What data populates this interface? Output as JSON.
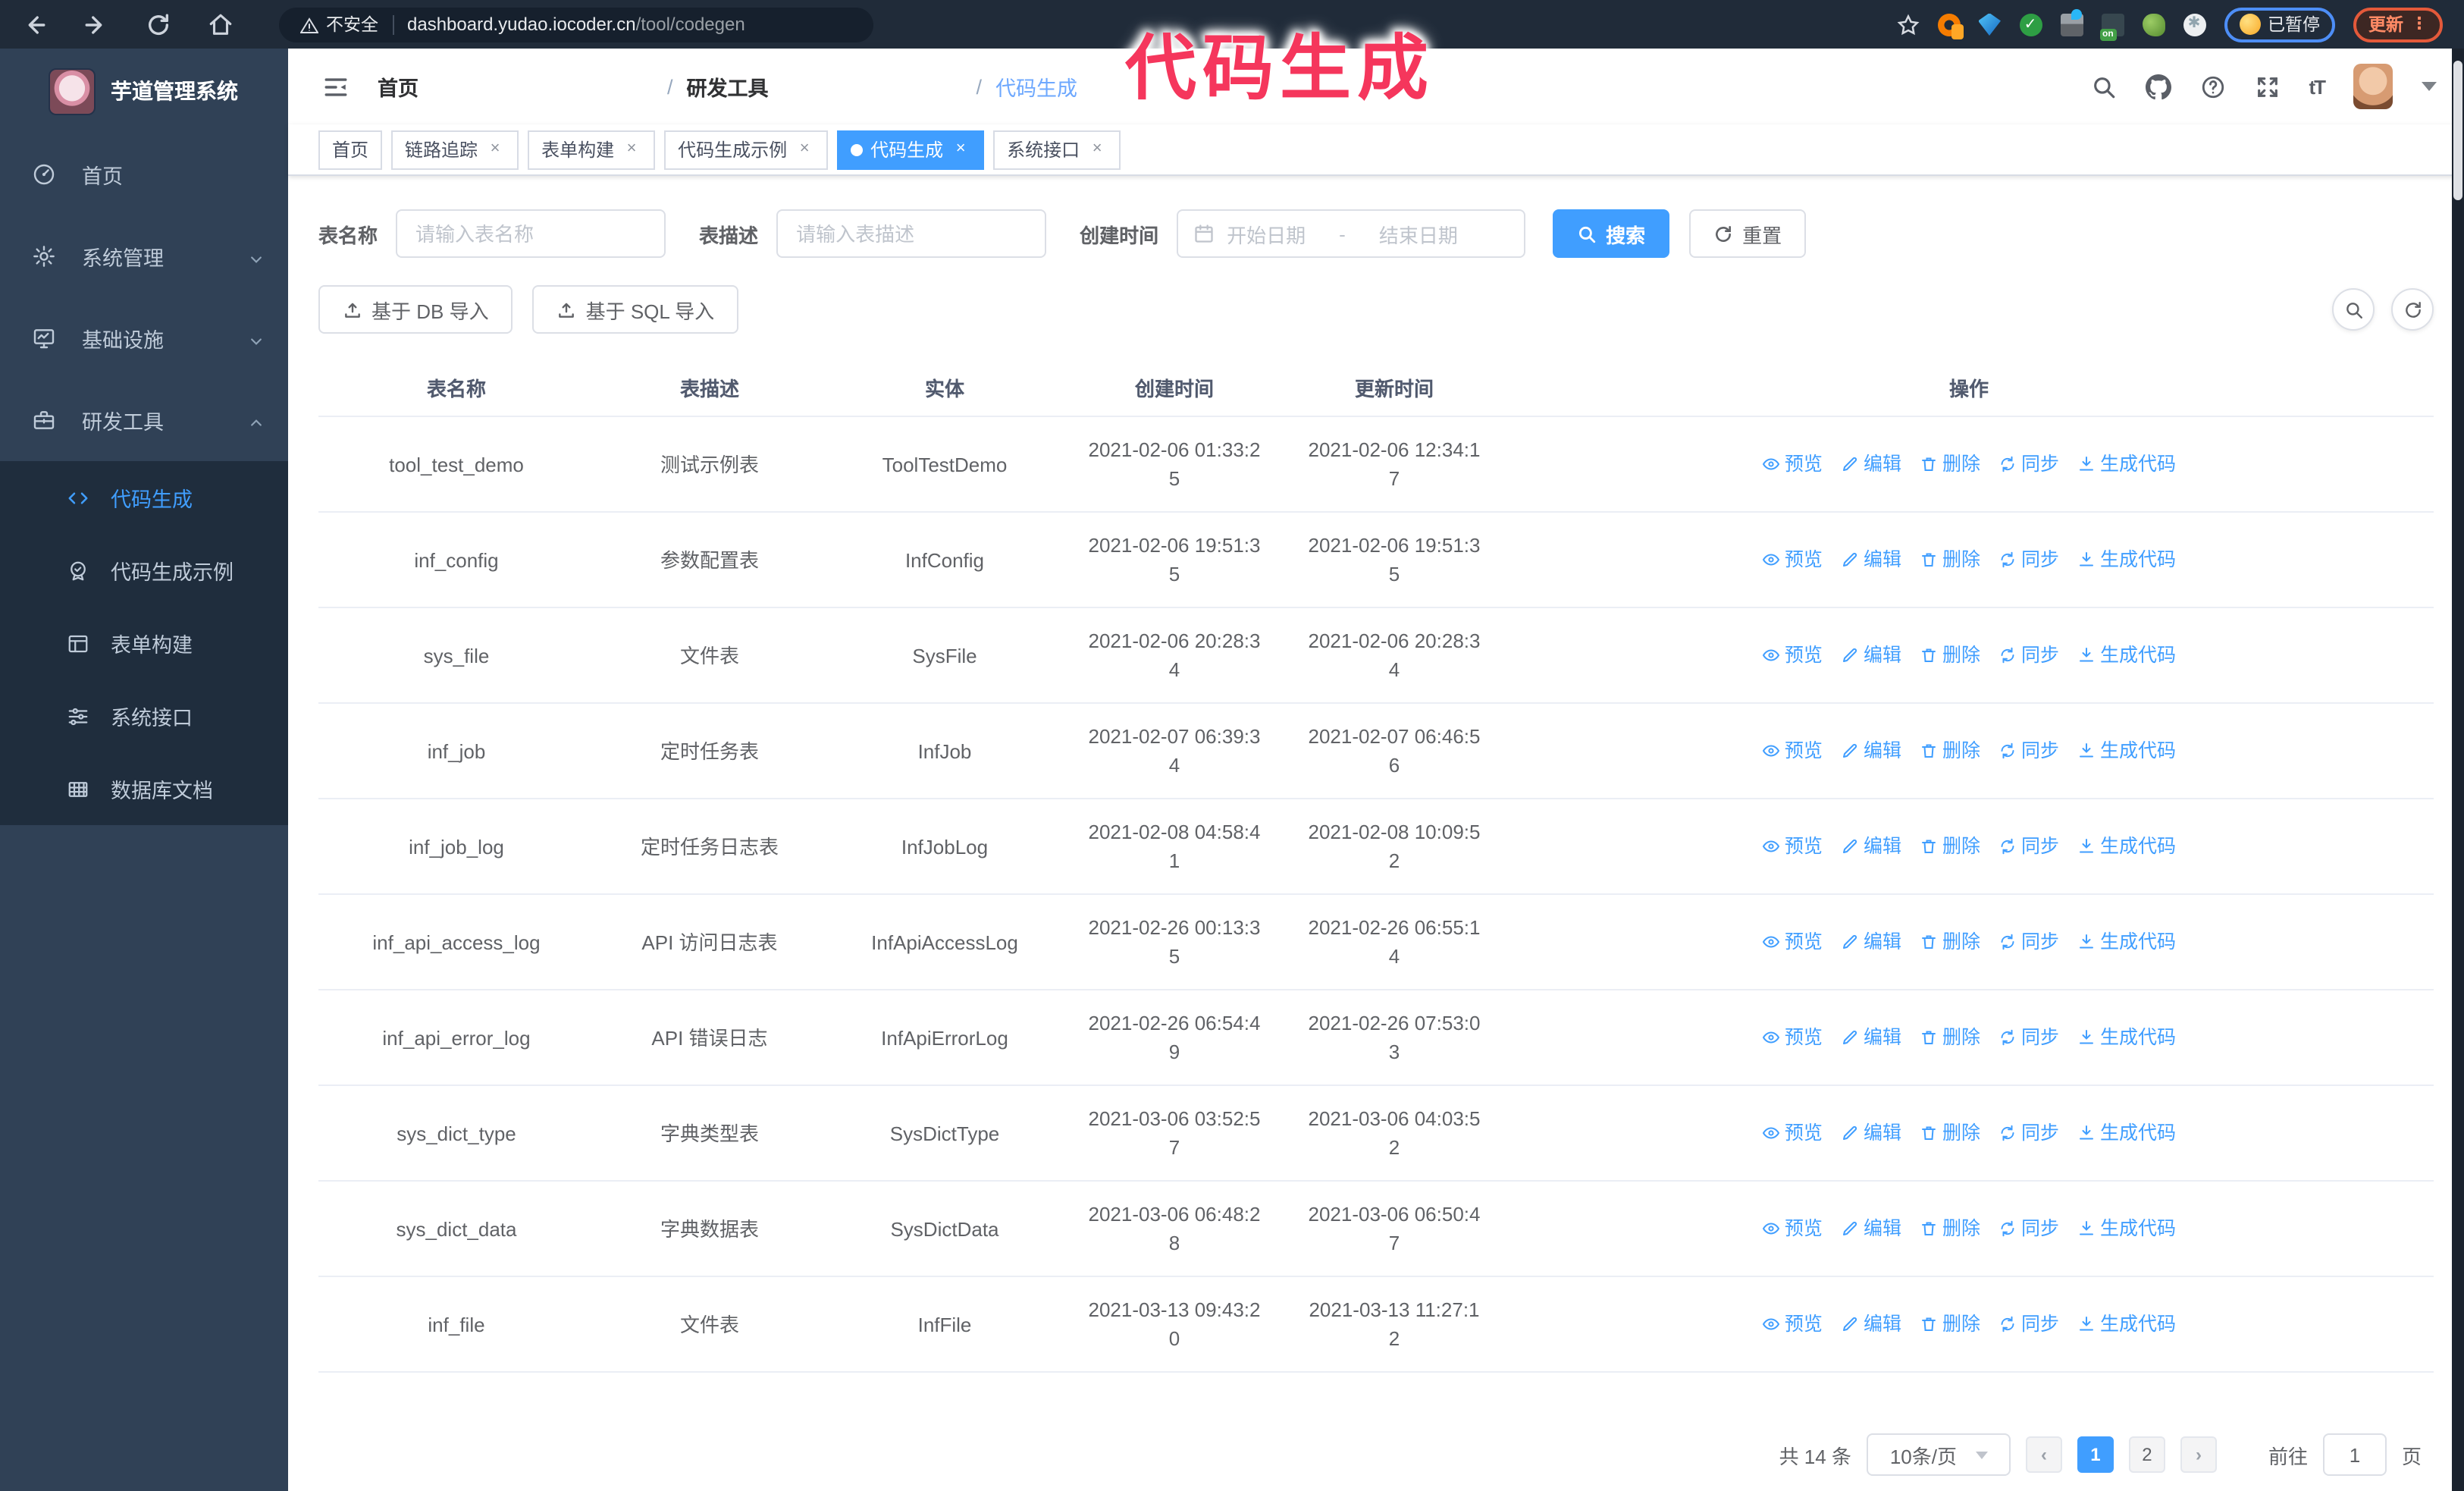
{
  "theme": {
    "accent": "#409eff",
    "sidebar": "#304156",
    "submenu": "#1f2d3d",
    "chrome": "#202b39",
    "annotation": "#f5365c"
  },
  "browser": {
    "security_label": "不安全",
    "url_host": "dashboard.yudao.iocoder.cn",
    "url_path": "/tool/codegen",
    "paused_badge": "已暂停",
    "update_button": "更新",
    "menu_dots": "⋮"
  },
  "annotation": {
    "text": "代码生成"
  },
  "sidebar": {
    "title": "芋道管理系统",
    "items": [
      {
        "label": "首页"
      },
      {
        "label": "系统管理"
      },
      {
        "label": "基础设施"
      },
      {
        "label": "研发工具"
      }
    ],
    "subitems": [
      {
        "label": "代码生成",
        "active": true
      },
      {
        "label": "代码生成示例"
      },
      {
        "label": "表单构建"
      },
      {
        "label": "系统接口"
      },
      {
        "label": "数据库文档"
      }
    ]
  },
  "breadcrumb": {
    "home": "首页",
    "section": "研发工具",
    "current": "代码生成",
    "separator": "/"
  },
  "tabs": [
    {
      "label": "首页"
    },
    {
      "label": "链路追踪"
    },
    {
      "label": "表单构建"
    },
    {
      "label": "代码生成示例"
    },
    {
      "label": "代码生成",
      "active": true
    },
    {
      "label": "系统接口"
    }
  ],
  "filters": {
    "name_label": "表名称",
    "name_placeholder": "请输入表名称",
    "desc_label": "表描述",
    "desc_placeholder": "请输入表描述",
    "time_label": "创建时间",
    "range_start": "开始日期",
    "range_separator": "-",
    "range_end": "结束日期",
    "search_label": "搜索",
    "reset_label": "重置"
  },
  "toolbar": {
    "import_db_label": "基于 DB 导入",
    "import_sql_label": "基于 SQL 导入"
  },
  "table": {
    "columns": [
      "表名称",
      "表描述",
      "实体",
      "创建时间",
      "更新时间",
      "操作"
    ],
    "actions": [
      "预览",
      "编辑",
      "删除",
      "同步",
      "生成代码"
    ],
    "rows": [
      {
        "name": "tool_test_demo",
        "desc": "测试示例表",
        "entity": "ToolTestDemo",
        "created": "2021-02-06 01:33:25",
        "updated": "2021-02-06 12:34:17"
      },
      {
        "name": "inf_config",
        "desc": "参数配置表",
        "entity": "InfConfig",
        "created": "2021-02-06 19:51:35",
        "updated": "2021-02-06 19:51:35"
      },
      {
        "name": "sys_file",
        "desc": "文件表",
        "entity": "SysFile",
        "created": "2021-02-06 20:28:34",
        "updated": "2021-02-06 20:28:34"
      },
      {
        "name": "inf_job",
        "desc": "定时任务表",
        "entity": "InfJob",
        "created": "2021-02-07 06:39:34",
        "updated": "2021-02-07 06:46:56"
      },
      {
        "name": "inf_job_log",
        "desc": "定时任务日志表",
        "entity": "InfJobLog",
        "created": "2021-02-08 04:58:41",
        "updated": "2021-02-08 10:09:52"
      },
      {
        "name": "inf_api_access_log",
        "desc": "API 访问日志表",
        "entity": "InfApiAccessLog",
        "created": "2021-02-26 00:13:35",
        "updated": "2021-02-26 06:55:14"
      },
      {
        "name": "inf_api_error_log",
        "desc": "API 错误日志",
        "entity": "InfApiErrorLog",
        "created": "2021-02-26 06:54:49",
        "updated": "2021-02-26 07:53:03"
      },
      {
        "name": "sys_dict_type",
        "desc": "字典类型表",
        "entity": "SysDictType",
        "created": "2021-03-06 03:52:57",
        "updated": "2021-03-06 04:03:52"
      },
      {
        "name": "sys_dict_data",
        "desc": "字典数据表",
        "entity": "SysDictData",
        "created": "2021-03-06 06:48:28",
        "updated": "2021-03-06 06:50:47"
      },
      {
        "name": "inf_file",
        "desc": "文件表",
        "entity": "InfFile",
        "created": "2021-03-13 09:43:20",
        "updated": "2021-03-13 11:27:12"
      }
    ]
  },
  "pagination": {
    "total_label": "共 14 条",
    "page_size_label": "10条/页",
    "prev": "‹",
    "pages": [
      "1",
      "2"
    ],
    "active_page": "1",
    "next": "›",
    "goto_label": "前往",
    "goto_value": "1",
    "page_suffix": "页"
  }
}
